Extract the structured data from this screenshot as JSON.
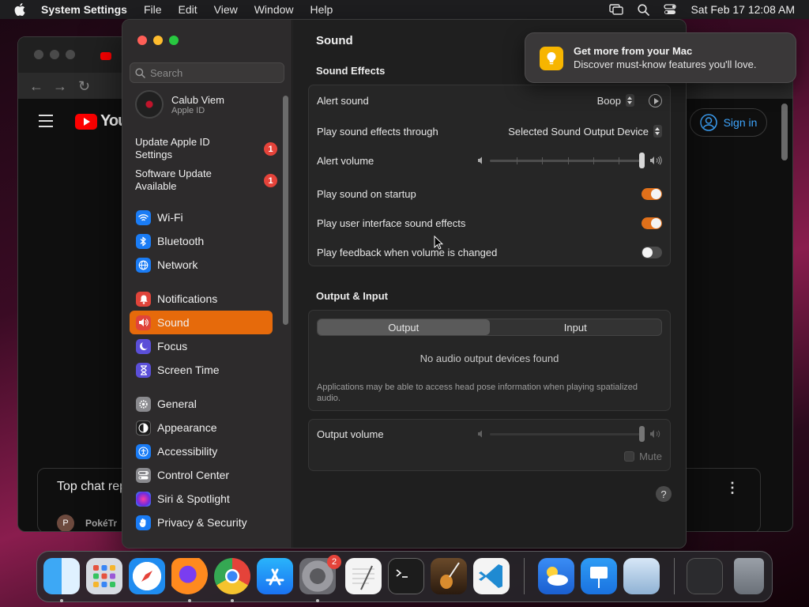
{
  "menubar": {
    "app_name": "System Settings",
    "menus": [
      "File",
      "Edit",
      "View",
      "Window",
      "Help"
    ],
    "clock": "Sat Feb 17  12:08 AM"
  },
  "browser": {
    "youtube_logo": "YouTube",
    "sign_in": "Sign in",
    "chat_title": "Top chat rep",
    "chat_user_initial": "P",
    "chat_user_name": "PokéTr"
  },
  "sidebar": {
    "search_placeholder": "Search",
    "profile_name": "Calub Viem",
    "profile_sub": "Apple ID",
    "notices": [
      {
        "label": "Update Apple ID Settings",
        "badge": "1"
      },
      {
        "label": "Software Update Available",
        "badge": "1"
      }
    ],
    "items": [
      {
        "label": "Wi-Fi",
        "icon": "wifi-icon",
        "color": "#1a7cf5"
      },
      {
        "label": "Bluetooth",
        "icon": "bluetooth-icon",
        "color": "#1a7cf5"
      },
      {
        "label": "Network",
        "icon": "globe-icon",
        "color": "#1a7cf5"
      },
      {
        "label": "Notifications",
        "icon": "bell-icon",
        "color": "#e0443a"
      },
      {
        "label": "Sound",
        "icon": "speaker-icon",
        "color": "#e0443a",
        "active": true
      },
      {
        "label": "Focus",
        "icon": "moon-icon",
        "color": "#5b4fd8"
      },
      {
        "label": "Screen Time",
        "icon": "hourglass-icon",
        "color": "#5b4fd8"
      },
      {
        "label": "General",
        "icon": "gear-icon",
        "color": "#8a8a8e"
      },
      {
        "label": "Appearance",
        "icon": "appearance-icon",
        "color": "#1c1c1c"
      },
      {
        "label": "Accessibility",
        "icon": "accessibility-icon",
        "color": "#1a7cf5"
      },
      {
        "label": "Control Center",
        "icon": "control-center-icon",
        "color": "#8a8a8e"
      },
      {
        "label": "Siri & Spotlight",
        "icon": "siri-icon",
        "color": "#b03cd8"
      },
      {
        "label": "Privacy & Security",
        "icon": "hand-icon",
        "color": "#1a7cf5"
      }
    ]
  },
  "sound": {
    "title": "Sound",
    "effects_heading": "Sound Effects",
    "alert_sound_label": "Alert sound",
    "alert_sound_value": "Boop",
    "play_through_label": "Play sound effects through",
    "play_through_value": "Selected Sound Output Device",
    "alert_volume_label": "Alert volume",
    "alert_volume_level": 1.0,
    "startup_label": "Play sound on startup",
    "startup_on": true,
    "ui_effects_label": "Play user interface sound effects",
    "ui_effects_on": true,
    "feedback_label": "Play feedback when volume is changed",
    "feedback_on": false,
    "output_heading": "Output & Input",
    "tab_output": "Output",
    "tab_input": "Input",
    "no_devices": "No audio output devices found",
    "hint": "Applications may be able to access head pose information when playing spatialized audio.",
    "output_volume_label": "Output volume",
    "output_volume_level": 1.0,
    "mute_label": "Mute",
    "help": "?"
  },
  "notification": {
    "title": "Get more from your Mac",
    "body": "Discover must-know features you'll love."
  },
  "dock": {
    "apps": [
      "Finder",
      "Launchpad",
      "Safari",
      "Firefox",
      "Chrome",
      "App Store",
      "System Settings",
      "TextEdit",
      "Terminal",
      "GarageBand",
      "Visual Studio Code",
      "Weather",
      "Keynote",
      "Preview",
      "Downloads",
      "Trash"
    ],
    "settings_badge": "2"
  }
}
